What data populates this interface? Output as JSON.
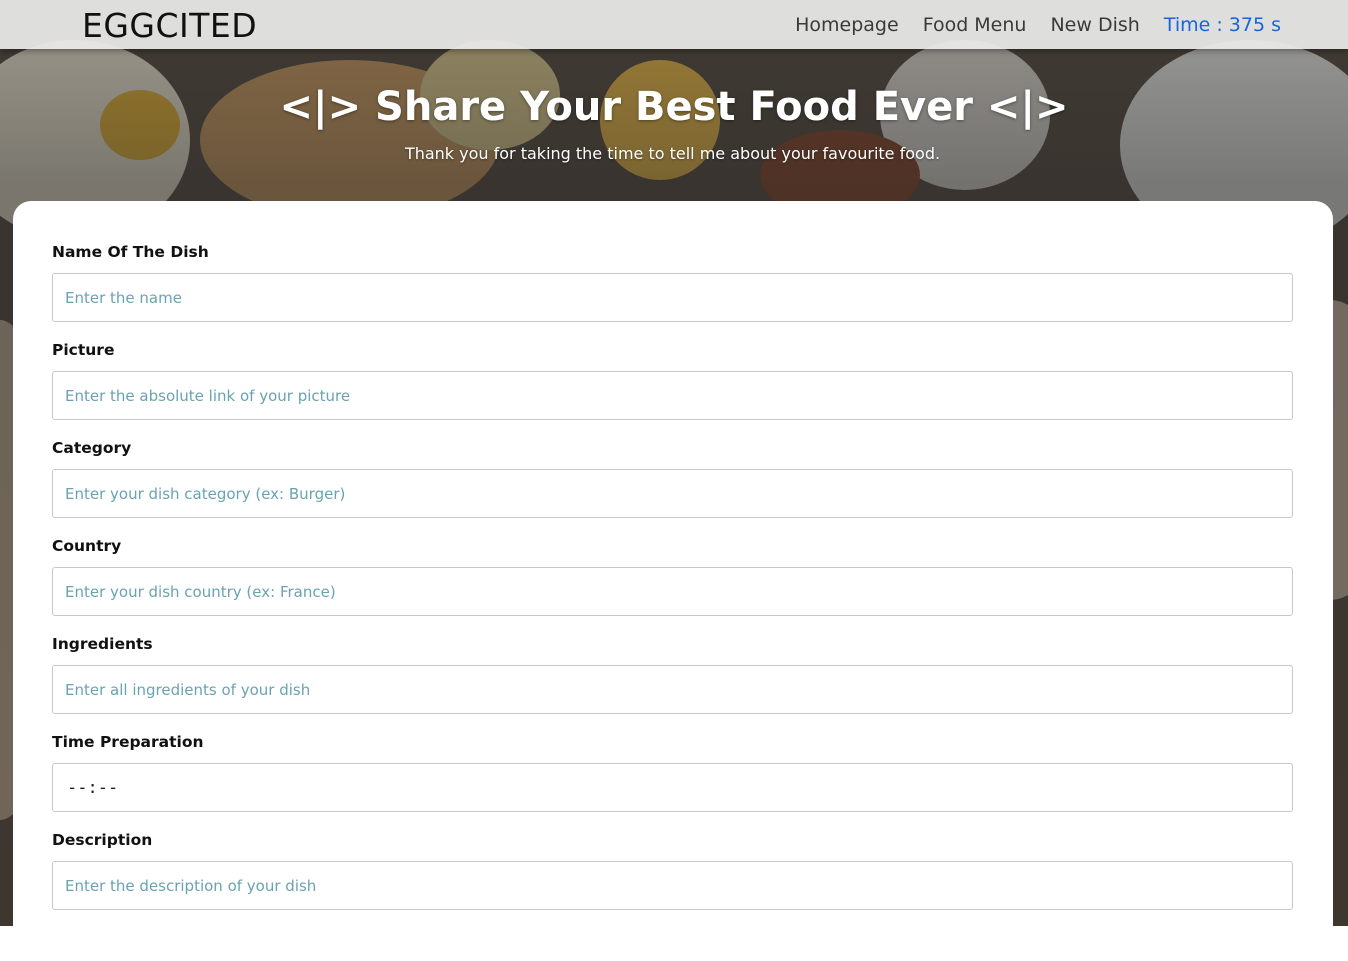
{
  "nav": {
    "brand": "EGGCITED",
    "links": [
      "Homepage",
      "Food Menu",
      "New Dish"
    ],
    "timer": "Time : 375 s",
    "timer_color": "#1a63d8"
  },
  "hero": {
    "title": "<|> Share Your Best Food Ever <|>",
    "subtitle": "Thank you for taking the time to tell me about your favourite food."
  },
  "form": {
    "fields": [
      {
        "label": "Name Of The Dish",
        "placeholder": "Enter the name"
      },
      {
        "label": "Picture",
        "placeholder": "Enter the absolute link of your picture"
      },
      {
        "label": "Category",
        "placeholder": "Enter your dish category (ex: Burger)"
      },
      {
        "label": "Country",
        "placeholder": "Enter your dish country (ex: France)"
      },
      {
        "label": "Ingredients",
        "placeholder": "Enter all ingredients of your dish"
      },
      {
        "label": "Time Preparation",
        "value": "--:--"
      },
      {
        "label": "Description",
        "placeholder": "Enter the description of your dish"
      }
    ]
  }
}
